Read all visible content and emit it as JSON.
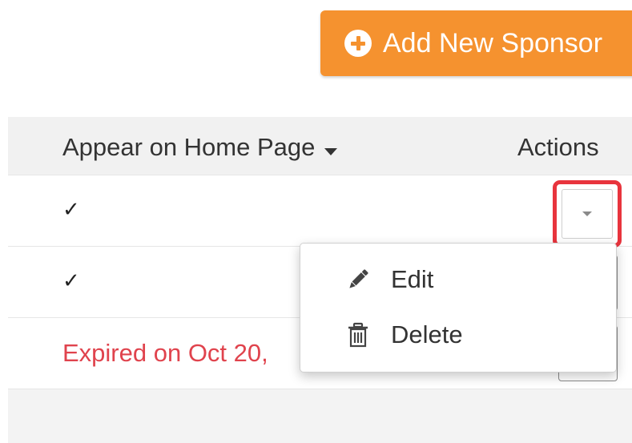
{
  "toolbar": {
    "add_button_label": "Add New Sponsor"
  },
  "table": {
    "columns": {
      "appear_on_home_page": "Appear on Home Page",
      "actions": "Actions"
    },
    "sort_indicator_icon": "caret-down-icon",
    "rows": [
      {
        "appear_on_home_page": "✓"
      },
      {
        "appear_on_home_page": "✓"
      },
      {
        "appear_on_home_page": "Expired on Oct 20,"
      }
    ]
  },
  "actions_menu": {
    "items": [
      {
        "label": "Edit",
        "icon": "pencil-icon"
      },
      {
        "label": "Delete",
        "icon": "trash-icon"
      }
    ]
  },
  "colors": {
    "primary_button": "#f5922f",
    "highlight_border": "#e8343d",
    "expired_text": "#e0434d",
    "header_background": "#f1f1f1"
  }
}
